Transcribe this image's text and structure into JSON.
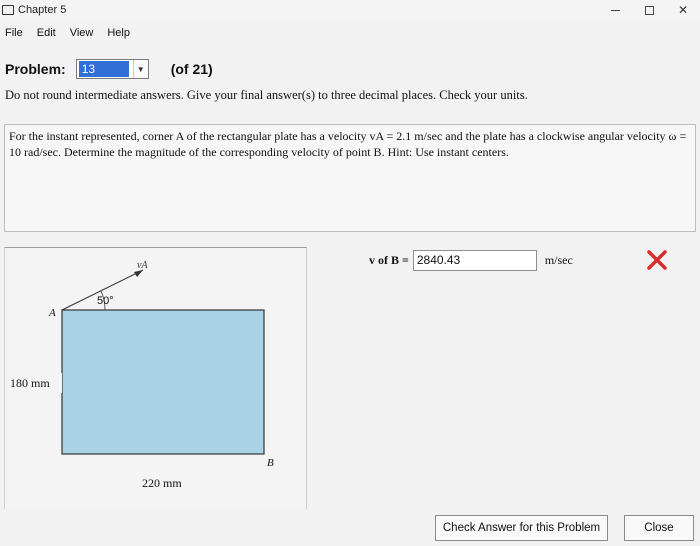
{
  "window": {
    "title": "Chapter 5",
    "controls": {
      "minimize": "—",
      "maximize": "☐",
      "close": "✕"
    }
  },
  "menu": {
    "items": [
      "File",
      "Edit",
      "View",
      "Help"
    ]
  },
  "problem": {
    "label": "Problem:",
    "selected": "13",
    "of_total": "(of 21)"
  },
  "instructions": "Do not round intermediate answers.  Give your final answer(s) to three decimal places.  Check your units.",
  "question": {
    "text": "For the instant represented, corner A of the rectangular plate has a velocity vA = 2.1 m/sec and the plate has a clockwise angular velocity ω = 10 rad/sec. Determine the magnitude of the corresponding velocity of point B. Hint: Use instant centers."
  },
  "figure": {
    "velocity_label": "vA",
    "angle_label": "50°",
    "corner_a": "A",
    "corner_b": "B",
    "height_label": "180 mm",
    "width_label": "220 mm",
    "plate_color": "#a9d3e4"
  },
  "answer": {
    "label": "v of B =",
    "value": "2840.43",
    "unit": "m/sec",
    "status": "incorrect",
    "status_color": "#d62c2c"
  },
  "buttons": {
    "check": "Check Answer for this Problem",
    "close": "Close"
  }
}
